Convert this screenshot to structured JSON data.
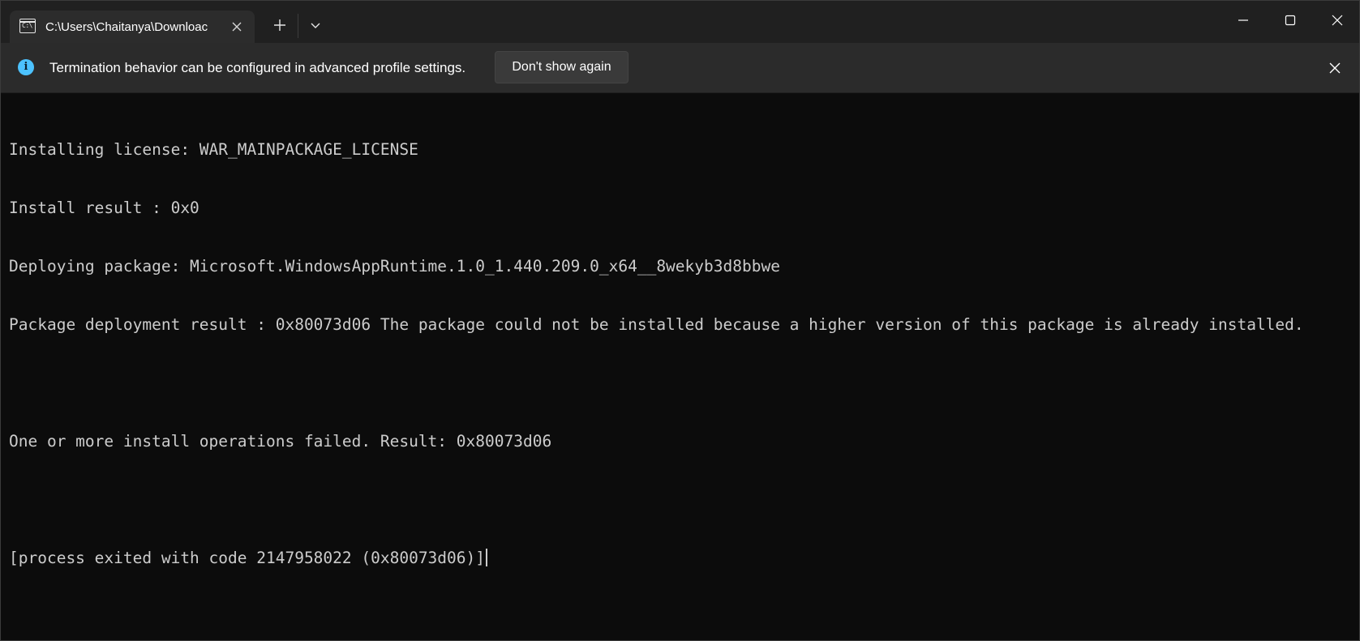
{
  "window": {
    "tab": {
      "title": "C:\\Users\\Chaitanya\\Downloac",
      "icon": "command-prompt-icon",
      "icon_glyph": "C:\\"
    },
    "controls": {
      "new_tab_icon": "plus-icon",
      "dropdown_icon": "chevron-down-icon",
      "minimize_icon": "minimize-icon",
      "maximize_icon": "maximize-icon",
      "close_icon": "close-icon"
    }
  },
  "infobar": {
    "icon": "info-icon",
    "message": "Termination behavior can be configured in advanced profile settings.",
    "button_label": "Don't show again",
    "close_icon": "close-icon",
    "accent_color": "#4cc2ff"
  },
  "terminal": {
    "lines": [
      "Installing license: WAR_MAINPACKAGE_LICENSE",
      "Install result : 0x0",
      "Deploying package: Microsoft.WindowsAppRuntime.1.0_1.440.209.0_x64__8wekyb3d8bbwe",
      "Package deployment result : 0x80073d06 The package could not be installed because a higher version of this package is already installed.",
      "",
      "One or more install operations failed. Result: 0x80073d06",
      "",
      "[process exited with code 2147958022 (0x80073d06)]"
    ],
    "text_color": "#cccccc",
    "background": "#0c0c0c"
  }
}
